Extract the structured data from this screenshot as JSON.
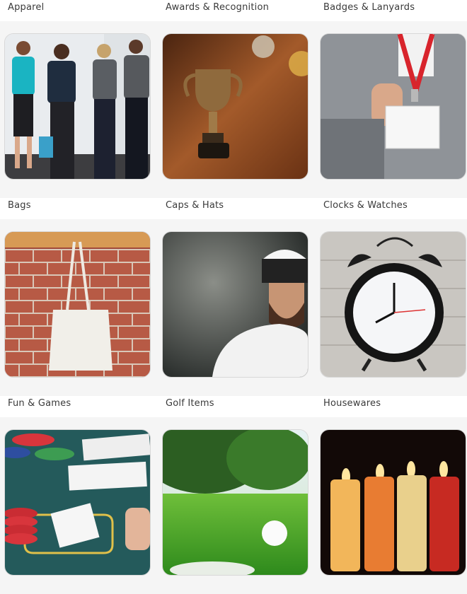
{
  "categories": [
    {
      "label": "Apparel",
      "icon": "apparel-team-photo"
    },
    {
      "label": "Awards & Recognition",
      "icon": "trophy-photo"
    },
    {
      "label": "Badges & Lanyards",
      "icon": "lanyard-badge-photo"
    },
    {
      "label": "Bags",
      "icon": "tote-bag-photo"
    },
    {
      "label": "Caps & Hats",
      "icon": "cap-man-photo"
    },
    {
      "label": "Clocks & Watches",
      "icon": "alarm-clock-photo"
    },
    {
      "label": "Fun & Games",
      "icon": "playing-cards-photo"
    },
    {
      "label": "Golf Items",
      "icon": "golf-ball-photo"
    },
    {
      "label": "Housewares",
      "icon": "candles-photo"
    }
  ]
}
